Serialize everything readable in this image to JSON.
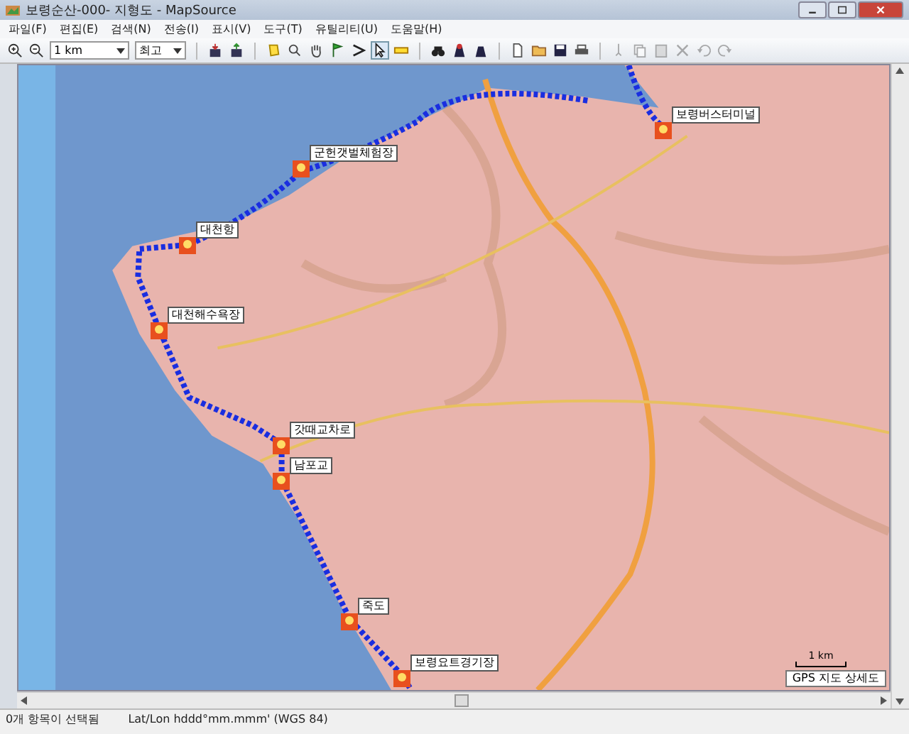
{
  "window": {
    "title": "보령순산-000- 지형도 - MapSource"
  },
  "menu": [
    "파일(F)",
    "편집(E)",
    "검색(N)",
    "전송(I)",
    "표시(V)",
    "도구(T)",
    "유틸리티(U)",
    "도움말(H)"
  ],
  "toolbar": {
    "scale": "1 km",
    "detail": "최고"
  },
  "waypoints": [
    {
      "label": "군헌갯벌체험장"
    },
    {
      "label": "대천항"
    },
    {
      "label": "대천해수욕장"
    },
    {
      "label": "갓때교차로"
    },
    {
      "label": "남포교"
    },
    {
      "label": "죽도"
    },
    {
      "label": "보령요트경기장"
    },
    {
      "label": "보령버스터미널"
    }
  ],
  "map": {
    "scale_label": "1 km",
    "map_type": "GPS 지도 상세도"
  },
  "status_bar": {
    "selection": "0개 항목이 선택됨",
    "position_format": "Lat/Lon hddd°mm.mmm' (WGS 84)"
  }
}
